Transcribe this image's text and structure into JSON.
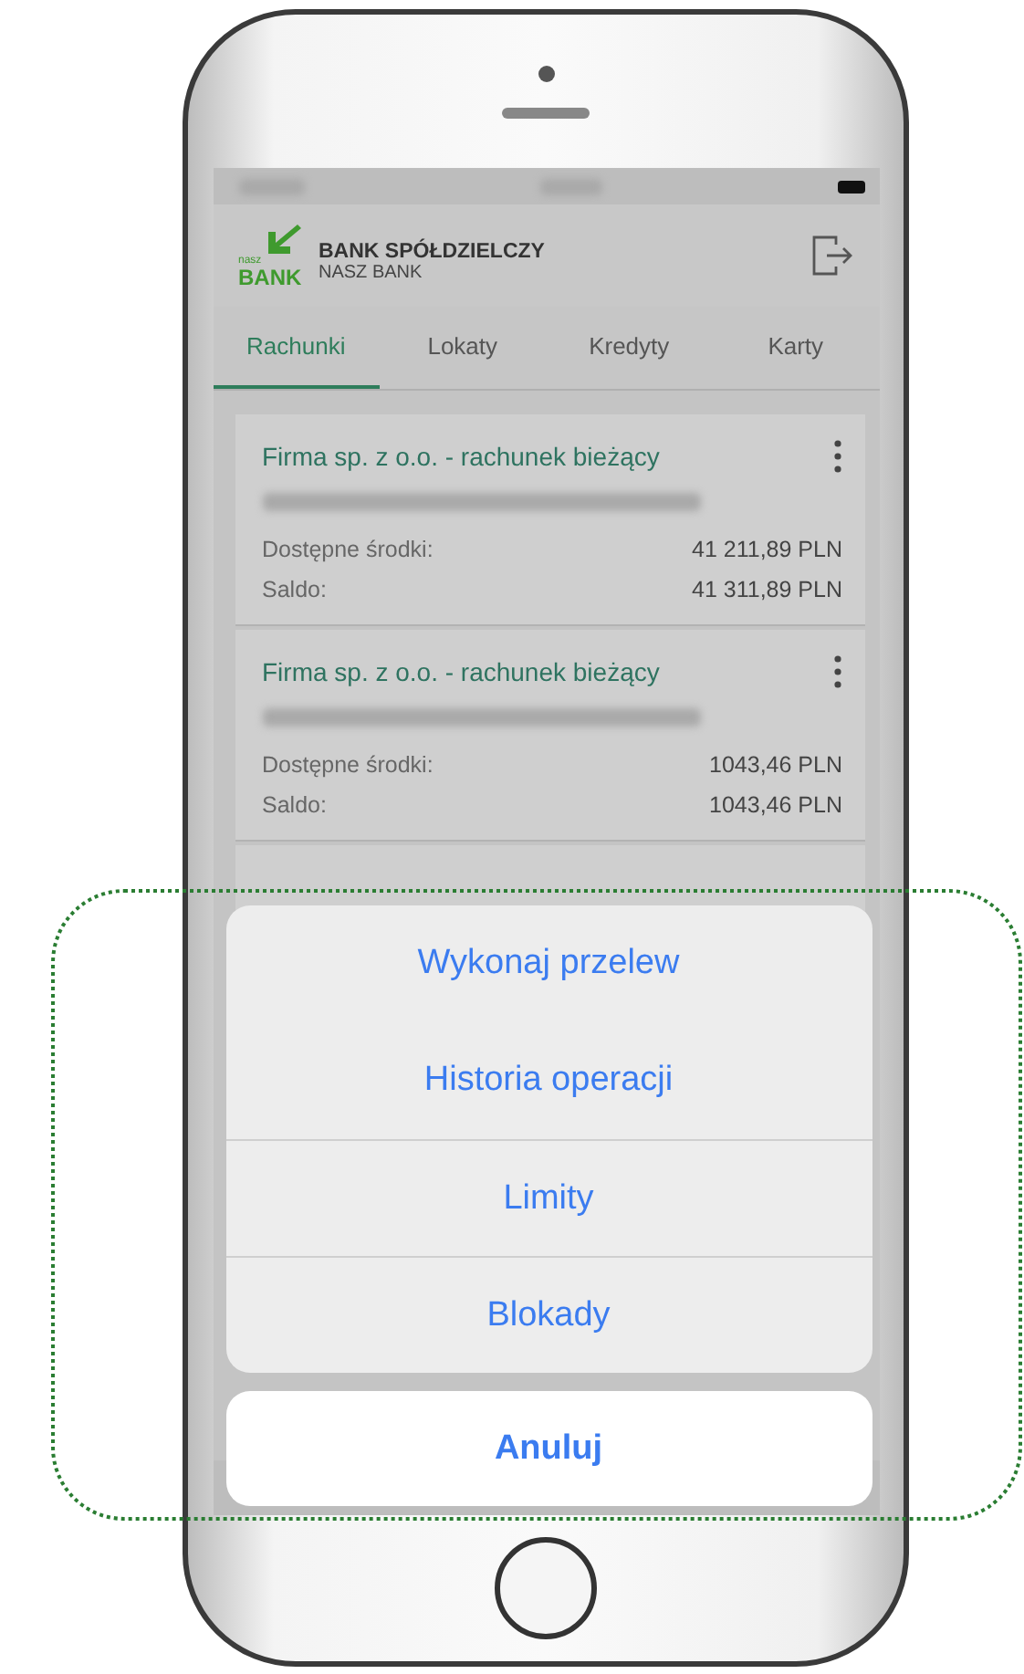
{
  "header": {
    "logo_small": "nasz",
    "logo_text": "BANK",
    "title": "BANK SPÓŁDZIELCZY",
    "subtitle": "NASZ BANK"
  },
  "tabs": [
    {
      "label": "Rachunki",
      "selected": true
    },
    {
      "label": "Lokaty",
      "selected": false
    },
    {
      "label": "Kredyty",
      "selected": false
    },
    {
      "label": "Karty",
      "selected": false
    }
  ],
  "accounts": [
    {
      "name": "Firma sp. z o.o. - rachunek bieżący",
      "rows": [
        {
          "label": "Dostępne środki:",
          "value": "41 211,89 PLN"
        },
        {
          "label": "Saldo:",
          "value": "41 311,89 PLN"
        }
      ]
    },
    {
      "name": "Firma sp. z o.o. - rachunek bieżący",
      "rows": [
        {
          "label": "Dostępne środki:",
          "value": "1043,46 PLN"
        },
        {
          "label": "Saldo:",
          "value": "1043,46 PLN"
        }
      ]
    }
  ],
  "action_sheet": {
    "actions": [
      "Wykonaj przelew",
      "Historia operacji",
      "Limity",
      "Blokady"
    ],
    "cancel": "Anuluj"
  }
}
